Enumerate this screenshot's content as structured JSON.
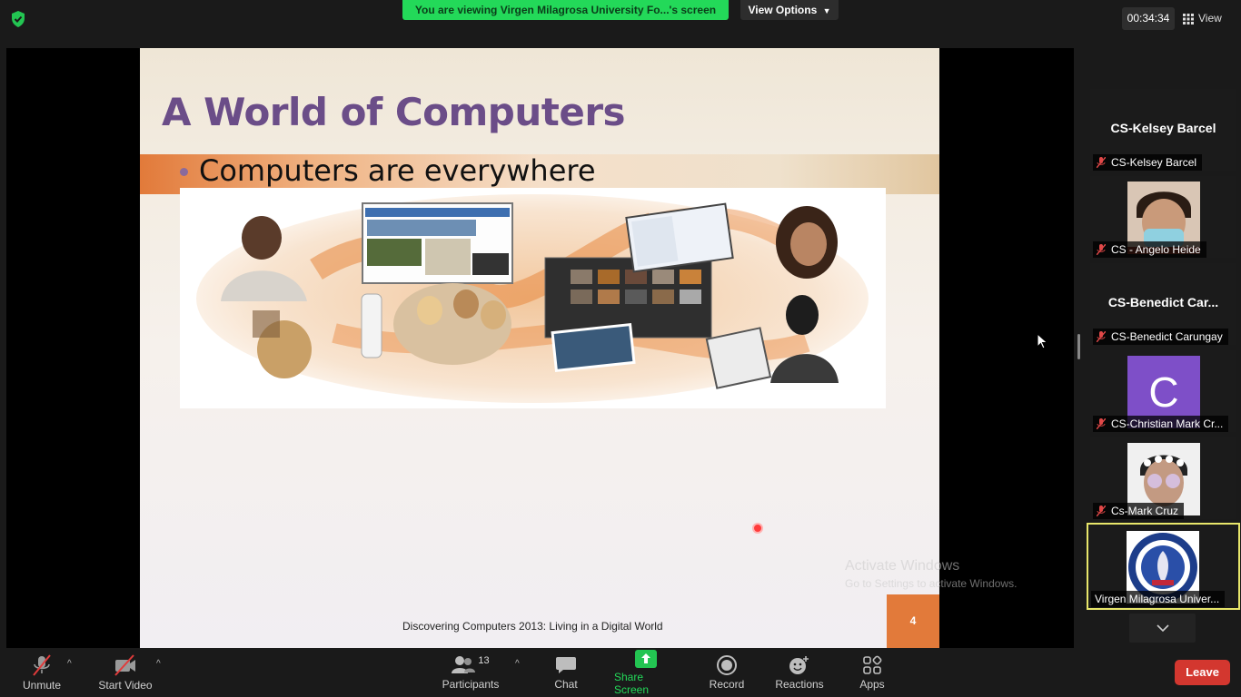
{
  "topbar": {
    "banner_text": "You are viewing Virgen Milagrosa University Fo...'s screen",
    "view_options_label": "View Options",
    "timer": "00:34:34",
    "view_label": "View"
  },
  "slide": {
    "title": "A World of Computers",
    "bullet": "Computers are everywhere",
    "footer": "Discovering Computers 2013: Living in a Digital World",
    "page_number": "4"
  },
  "watermark": {
    "line1": "Activate Windows",
    "line2": "Go to Settings to activate Windows."
  },
  "participants": [
    {
      "big_name": "CS-Kelsey Barcel",
      "label": "CS-Kelsey Barcel",
      "muted": true,
      "type": "name"
    },
    {
      "big_name": "",
      "label": "CS - Angelo Heide",
      "muted": true,
      "type": "photo"
    },
    {
      "big_name": "CS-Benedict  Car...",
      "label": "CS-Benedict Carungay",
      "muted": true,
      "type": "name"
    },
    {
      "big_name": "C",
      "label": "CS-Christian Mark  Cr...",
      "muted": true,
      "type": "avatar-letter"
    },
    {
      "big_name": "",
      "label": "Cs-Mark Cruz",
      "muted": true,
      "type": "photo"
    },
    {
      "big_name": "",
      "label": "Virgen Milagrosa Univer...",
      "muted": false,
      "type": "logo"
    }
  ],
  "toolbar": {
    "unmute": "Unmute",
    "start_video": "Start Video",
    "participants": "Participants",
    "participants_count": "13",
    "chat": "Chat",
    "share_screen": "Share Screen",
    "record": "Record",
    "reactions": "Reactions",
    "apps": "Apps",
    "leave": "Leave"
  },
  "colors": {
    "banner_green": "#23d959",
    "leave_red": "#d3372f",
    "active_speaker": "#e8e66b",
    "slide_title": "#6b4d88",
    "slide_accent": "#e27a3a",
    "avatar_purple": "#7e4fc8"
  }
}
